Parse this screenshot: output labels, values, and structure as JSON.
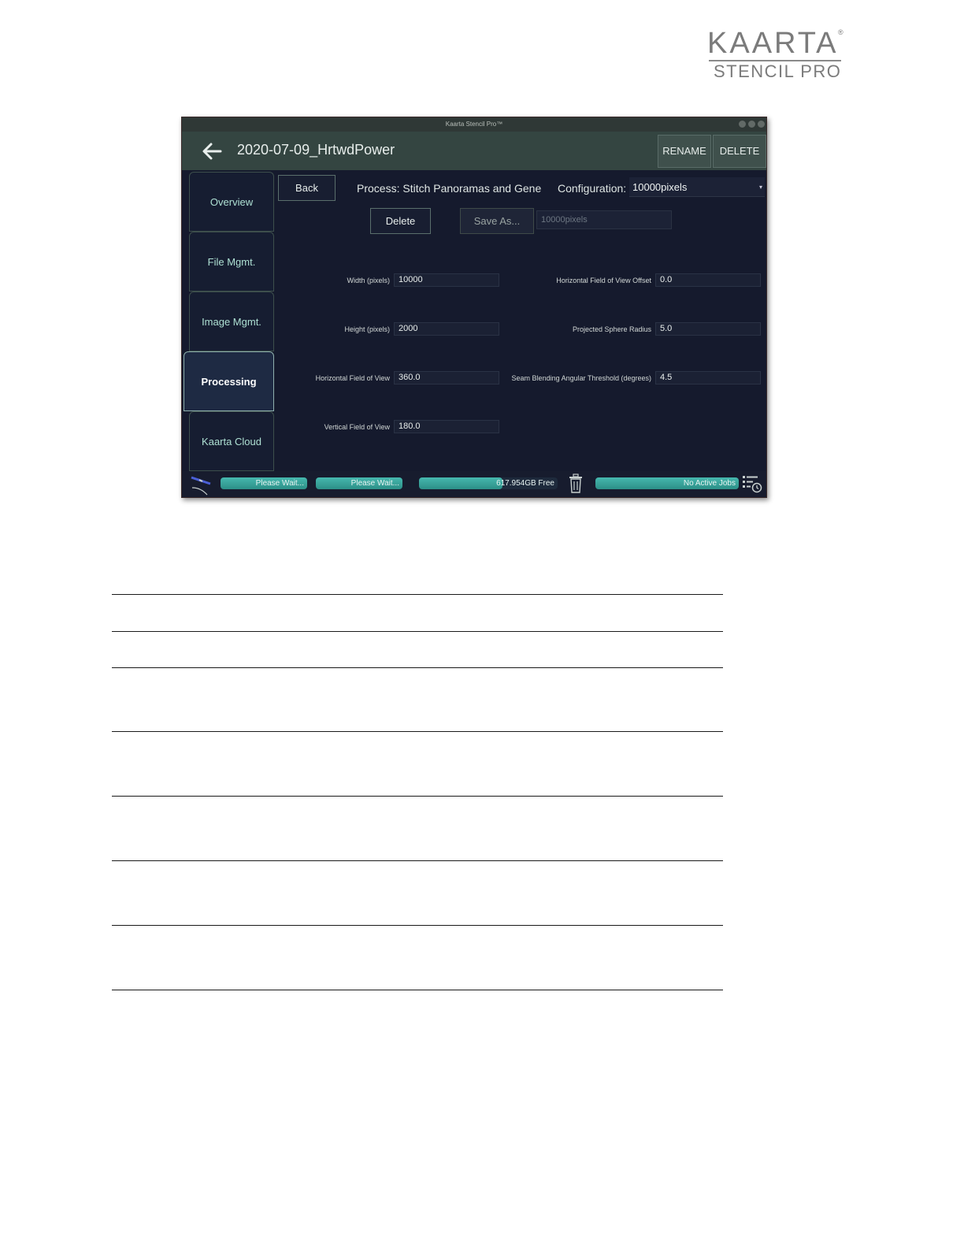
{
  "logo": {
    "line1": "KAARTA",
    "registered": "®",
    "line2": "STENCIL PRO"
  },
  "window": {
    "titlebar": "Kaarta Stencil Pro™",
    "project_title": "2020-07-09_HrtwdPower",
    "rename_label": "RENAME",
    "delete_label": "DELETE"
  },
  "sidebar": {
    "items": [
      {
        "label": "Overview"
      },
      {
        "label": "File Mgmt."
      },
      {
        "label": "Image Mgmt."
      },
      {
        "label": "Processing"
      },
      {
        "label": "Kaarta Cloud"
      }
    ],
    "active": "Processing"
  },
  "processing": {
    "back_label": "Back",
    "process_text": "Process: Stitch Panoramas and Gene",
    "configuration_label": "Configuration:",
    "configuration_value": "10000pixels",
    "delete_label": "Delete",
    "save_as_label": "Save As...",
    "name_placeholder": "10000pixels",
    "fields_left": [
      {
        "label": "Width (pixels)",
        "value": "10000"
      },
      {
        "label": "Height (pixels)",
        "value": "2000"
      },
      {
        "label": "Horizontal Field of View",
        "value": "360.0"
      },
      {
        "label": "Vertical Field of View",
        "value": "180.0"
      }
    ],
    "fields_right": [
      {
        "label": "Horizontal Field of View Offset",
        "value": "0.0"
      },
      {
        "label": "Projected Sphere Radius",
        "value": "5.0"
      },
      {
        "label": "Seam Blending Angular Threshold (degrees)",
        "value": "4.5"
      }
    ]
  },
  "statusbar": {
    "bar1": "Please Wait...",
    "bar2": "Please Wait...",
    "storage": "617.954GB Free",
    "storage_used_fraction": 0.6,
    "jobs": "No Active Jobs",
    "icons": [
      "satellite-icon",
      "trash-icon",
      "job-list-icon"
    ]
  },
  "colors": {
    "accent": "#3aa89f",
    "background": "#151a2d",
    "header": "#344541"
  }
}
